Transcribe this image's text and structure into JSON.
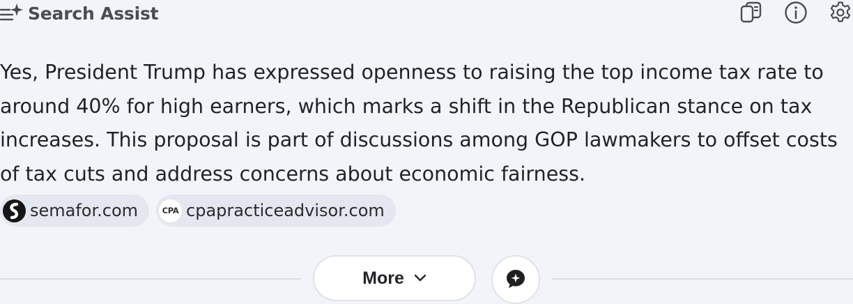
{
  "header": {
    "title": "Search Assist",
    "brand_icon": "sparkle-list-icon",
    "actions": [
      {
        "name": "copy-icon"
      },
      {
        "name": "info-icon"
      },
      {
        "name": "gear-icon"
      }
    ]
  },
  "answer": {
    "text": "Yes, President Trump has expressed openness to raising the top income tax rate to around 40% for high earners, which marks a shift in the Republican stance on tax increases. This proposal is part of discussions among GOP lawmakers to offset costs of tax cuts and address concerns about economic fairness."
  },
  "sources": [
    {
      "label": "semafor.com",
      "logo": "semafor-logo"
    },
    {
      "label": "cpapracticeadvisor.com",
      "logo_text": "CPA"
    }
  ],
  "footer": {
    "more_label": "More",
    "more_icon": "chevron-down-icon",
    "feedback_icon": "chat-sparkle-icon"
  },
  "colors": {
    "background": "#f2f4f9",
    "chip_background": "#e4e7ef",
    "text": "#222326",
    "muted_title": "#4b4d52"
  }
}
